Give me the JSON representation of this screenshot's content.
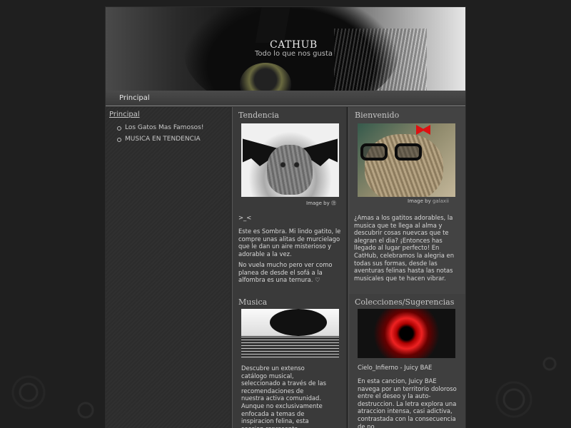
{
  "header": {
    "title": "CATHUB",
    "tagline": "Todo lo que nos gusta"
  },
  "nav": {
    "items": [
      "Principal"
    ]
  },
  "sidebar": {
    "title": "Principal",
    "links": [
      "Los Gatos Mas Famosos!",
      "MUSICA EN TENDENCIA"
    ]
  },
  "panels": {
    "tendencia": {
      "title": "Tendencia",
      "image_credit_label": "Image by",
      "image_credit_name": "㊟",
      "heading": ">_<",
      "paragraphs": [
        "Este es Sombra. Mi lindo gatito, le compre unas alitas de murcielago que le dan un aire misterioso y adorable a la vez.",
        "No vuela mucho pero ver como planea de desde el sofá a la alfombra es una ternura. ♡"
      ]
    },
    "bienvenido": {
      "title": "Bienvenido",
      "image_credit_label": "Image by",
      "image_credit_name": "galaxii",
      "paragraph": "¿Amas a los gatitos adorables, la musica que te llega al alma y descubrir cosas nuevcas que te alegran el dia? ¡Entonces has llegado al lugar perfecto! En CatHub, celebramos la alegria en todas sus formas, desde las aventuras felinas hasta las notas musicales que te hacen vibrar."
    },
    "musica": {
      "title": "Musica",
      "paragraph": "Descubre un extenso catálogo musical, seleccionado a través de las recomendaciones de nuestra activa comunidad. Aunque no exclusivamente enfocada a temas de inspiracion felina, esta seccion representa homenaje a la apreciación"
    },
    "colecciones": {
      "title": "Colecciones/Sugerencias",
      "heading": "Cielo_Infierno - Juicy BAE",
      "paragraph": "En esta cancion, Juicy BAE navega por un territorio doloroso entre el deseo y la auto-destruccion. La letra explora una atraccion intensa, casi adictiva, contrastada con la consecuencia de no"
    }
  }
}
